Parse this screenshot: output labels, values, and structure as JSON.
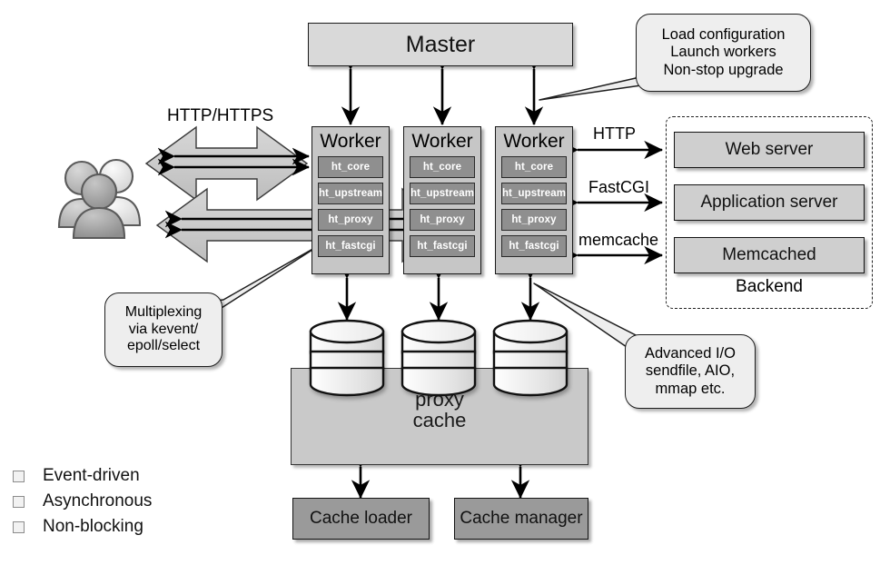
{
  "diagram": {
    "title_master": "Master",
    "worker_title": "Worker",
    "modules": [
      "ht_core",
      "ht_upstream",
      "ht_proxy",
      "ht_fastcgi"
    ],
    "workers": [
      {
        "title": "Worker",
        "modules": [
          "ht_core",
          "ht_upstream",
          "ht_proxy",
          "ht_fastcgi"
        ]
      },
      {
        "title": "Worker",
        "modules": [
          "ht_core",
          "ht_upstream",
          "ht_proxy",
          "ht_fastcgi"
        ]
      },
      {
        "title": "Worker",
        "modules": [
          "ht_core",
          "ht_upstream",
          "ht_proxy",
          "ht_fastcgi"
        ]
      }
    ],
    "backend": {
      "label": "Backend",
      "items": [
        "Web server",
        "Application server",
        "Memcached"
      ],
      "protocols": [
        "HTTP",
        "FastCGI",
        "memcache"
      ]
    },
    "client_protocol": "HTTP/HTTPS",
    "cache": {
      "title_line1": "proxy",
      "title_line2": "cache",
      "loader": "Cache loader",
      "manager": "Cache manager"
    },
    "callouts": {
      "master": "Load configuration\nLaunch workers\nNon-stop upgrade",
      "master_lines": [
        "Load configuration",
        "Launch workers",
        "Non-stop upgrade"
      ],
      "multiplexing_lines": [
        "Multiplexing",
        "via kevent/",
        "epoll/select"
      ],
      "io_lines": [
        "Advanced I/O",
        "sendfile, AIO,",
        "mmap etc."
      ]
    },
    "legend": [
      "Event-driven",
      "Asynchronous",
      "Non-blocking"
    ],
    "icons": {
      "users": "users-icon",
      "database": "database-cylinder-icon",
      "bullet": "square-bullet-icon"
    },
    "colors": {
      "box_fill": "#cfcfcf",
      "worker_fill": "#c6c6c6",
      "module_fill": "#8f8f8f",
      "cache_btn_fill": "#9a9a9a",
      "proxy_cache_fill": "#c9c9c9",
      "callout_fill": "#eeeeee",
      "arrow_stroke": "#000000",
      "big_arrow_fill": "#cccccc",
      "background": "#ffffff"
    }
  }
}
